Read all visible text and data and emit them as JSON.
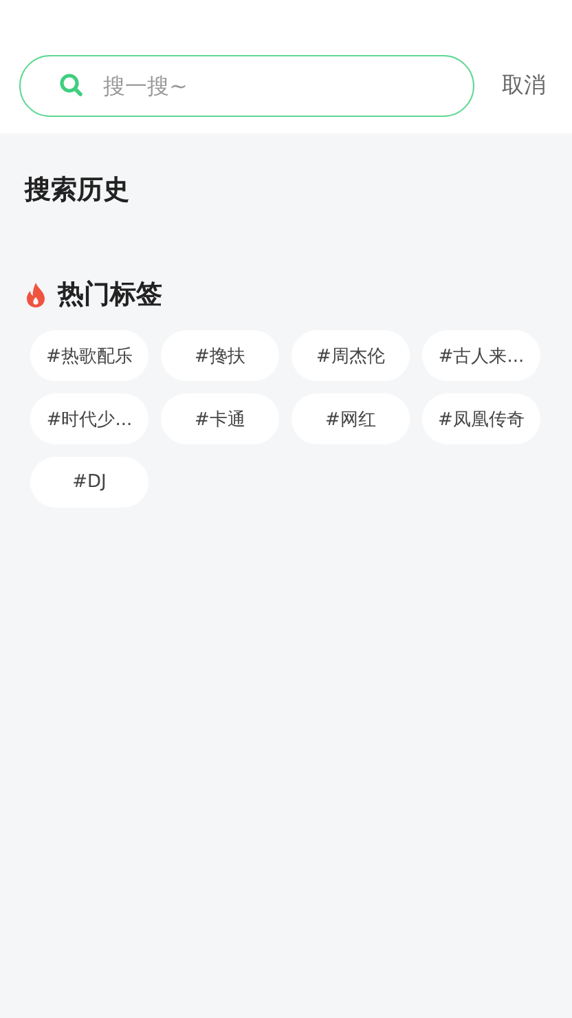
{
  "search": {
    "placeholder": "搜一搜~",
    "cancel": "取消"
  },
  "history": {
    "title": "搜索历史"
  },
  "hot_tags": {
    "title": "热门标签",
    "tags": [
      {
        "label": "#热歌配乐"
      },
      {
        "label": "#搀扶"
      },
      {
        "label": "#周杰伦"
      },
      {
        "label": "#古人来..."
      },
      {
        "label": "#时代少..."
      },
      {
        "label": "#卡通"
      },
      {
        "label": "#网红"
      },
      {
        "label": "#凤凰传奇"
      },
      {
        "label": "#DJ"
      }
    ]
  }
}
